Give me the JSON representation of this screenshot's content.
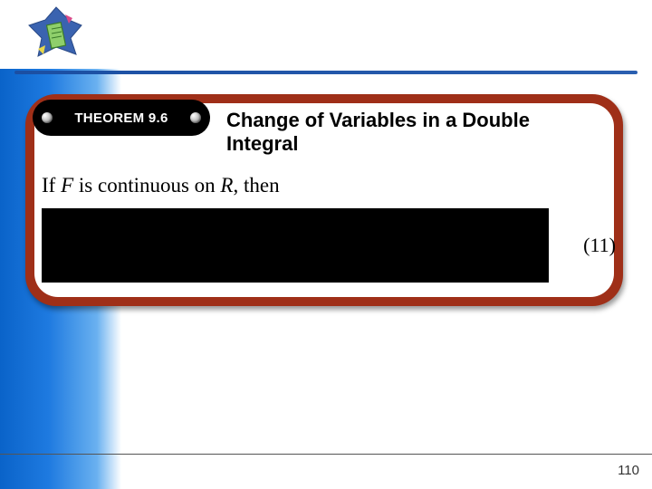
{
  "theorem": {
    "tag": "THEOREM 9.6",
    "title": "Change of Variables in a Double Integral",
    "body_pre": "If ",
    "body_F": "F",
    "body_mid": " is continuous on ",
    "body_R": "R",
    "body_post": ", then",
    "equation_number": "(11)"
  },
  "page_number": "110"
}
